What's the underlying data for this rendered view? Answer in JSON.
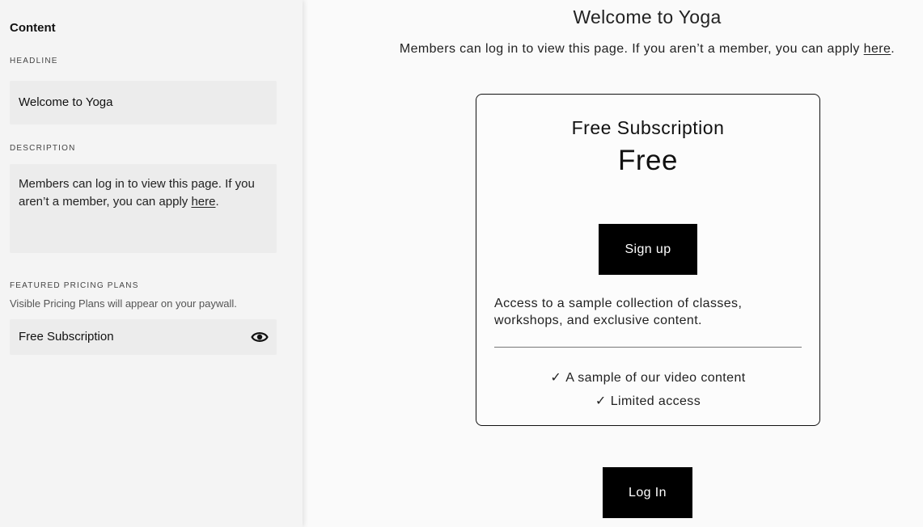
{
  "editor": {
    "title": "Content",
    "headline_label": "HEADLINE",
    "headline_value": "Welcome to Yoga",
    "description_label": "DESCRIPTION",
    "description_text": "Members can log in to view this page. If you aren’t a member, you can apply ",
    "description_link": "here",
    "description_end": ".",
    "plans_label": "FEATURED PRICING PLANS",
    "plans_helper": "Visible Pricing Plans will appear on your paywall.",
    "plans": [
      {
        "name": "Free Subscription",
        "visibility_icon": "eye-icon"
      }
    ]
  },
  "preview": {
    "title": "Welcome to Yoga",
    "description_text": "Members can log in to view this page. If you aren’t a member, you can apply ",
    "description_link": "here",
    "description_end": ".",
    "plan": {
      "name": "Free Subscription",
      "price": "Free",
      "button_label": "Sign up",
      "description": "Access to a sample collection of classes, workshops, and exclusive content.",
      "check_glyph": "✓",
      "features": [
        "A sample of our video content",
        "Limited access"
      ]
    },
    "login_label": "Log In"
  }
}
